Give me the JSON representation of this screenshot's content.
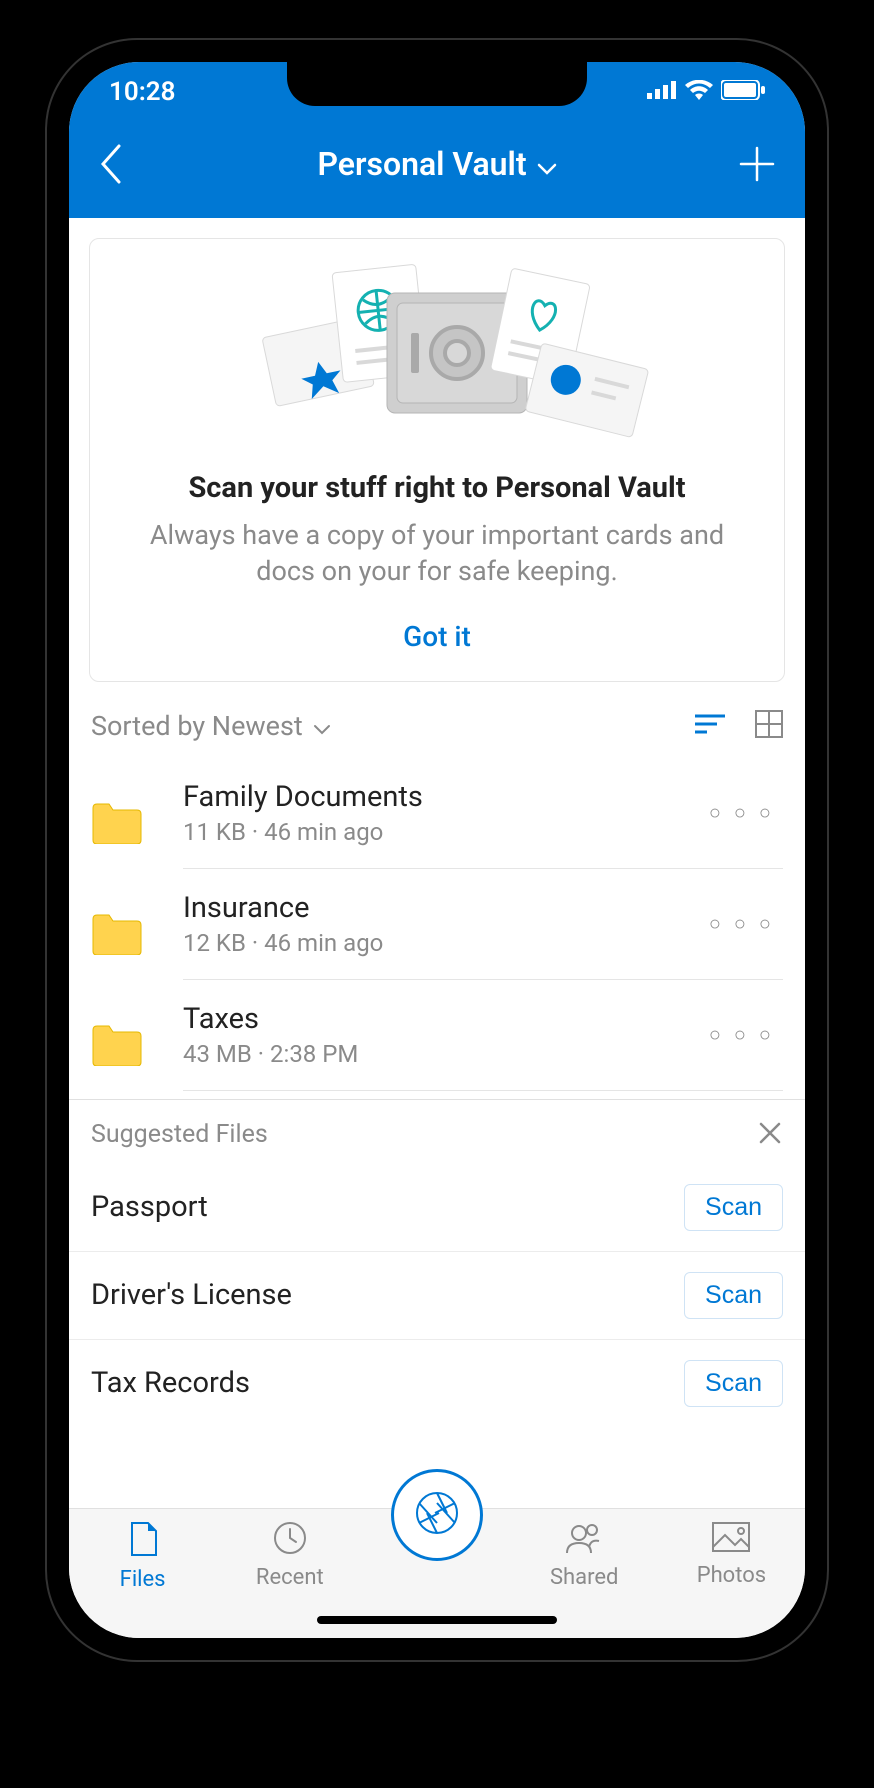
{
  "statusbar": {
    "time": "10:28"
  },
  "header": {
    "title": "Personal Vault"
  },
  "promo": {
    "title": "Scan your stuff right to Personal Vault",
    "description": "Always have a copy of your important cards and docs on your for safe keeping.",
    "action": "Got it"
  },
  "sort": {
    "label": "Sorted by Newest"
  },
  "files": [
    {
      "name": "Family Documents",
      "meta": "11 KB · 46 min ago"
    },
    {
      "name": "Insurance",
      "meta": "12 KB · 46 min ago"
    },
    {
      "name": "Taxes",
      "meta": "43 MB · 2:38 PM"
    }
  ],
  "suggested": {
    "title": "Suggested Files",
    "scan_label": "Scan",
    "items": [
      {
        "name": "Passport"
      },
      {
        "name": "Driver's License"
      },
      {
        "name": "Tax Records"
      }
    ]
  },
  "tabs": {
    "files": "Files",
    "recent": "Recent",
    "shared": "Shared",
    "photos": "Photos"
  }
}
